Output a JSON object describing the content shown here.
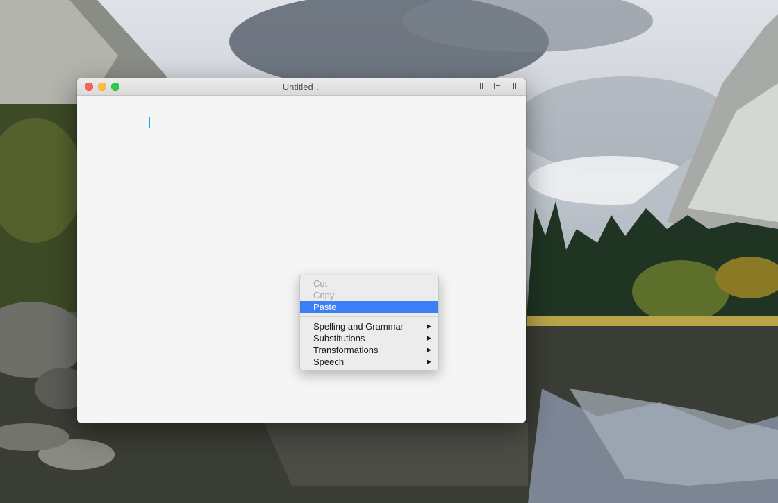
{
  "window": {
    "title": "Untitled",
    "title_chevron": "⌄"
  },
  "context_menu": {
    "items": [
      {
        "label": "Cut",
        "enabled": false
      },
      {
        "label": "Copy",
        "enabled": false
      },
      {
        "label": "Paste",
        "enabled": true,
        "highlighted": true
      }
    ],
    "submenus": [
      {
        "label": "Spelling and Grammar",
        "arrow": "▶"
      },
      {
        "label": "Substitutions",
        "arrow": "▶"
      },
      {
        "label": "Transformations",
        "arrow": "▶"
      },
      {
        "label": "Speech",
        "arrow": "▶"
      }
    ]
  },
  "colors": {
    "highlight": "#3a7ff6",
    "caret": "#1fa4db",
    "close": "#fc605c",
    "minimize": "#fdbc40",
    "zoom": "#34c84a"
  },
  "icons": [
    "sidebar-left-icon",
    "toolbar-toggle-icon",
    "sidebar-right-icon",
    "chevron-down-icon"
  ]
}
